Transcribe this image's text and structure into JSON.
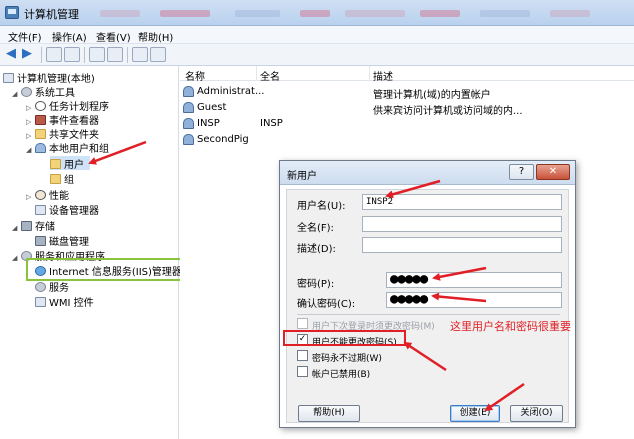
{
  "window": {
    "title": "计算机管理"
  },
  "menu": [
    "文件(F)",
    "操作(A)",
    "查看(V)",
    "帮助(H)"
  ],
  "tree": [
    {
      "label": "计算机管理(本地)",
      "icon": "computer-icon",
      "level": 0,
      "expanded": true
    },
    {
      "label": "系统工具",
      "icon": "tools-icon",
      "level": 1,
      "expanded": true
    },
    {
      "label": "任务计划程序",
      "icon": "clock-icon",
      "level": 2,
      "expanded": false
    },
    {
      "label": "事件查看器",
      "icon": "event-viewer-icon",
      "level": 2,
      "expanded": false
    },
    {
      "label": "共享文件夹",
      "icon": "shared-folder-icon",
      "level": 2,
      "expanded": false
    },
    {
      "label": "本地用户和组",
      "icon": "users-group-icon",
      "level": 2,
      "expanded": true
    },
    {
      "label": "用户",
      "icon": "folder-icon",
      "level": 3,
      "selected": true
    },
    {
      "label": "组",
      "icon": "folder-icon",
      "level": 3
    },
    {
      "label": "性能",
      "icon": "performance-icon",
      "level": 2,
      "expanded": false
    },
    {
      "label": "设备管理器",
      "icon": "device-manager-icon",
      "level": 2
    },
    {
      "label": "存储",
      "icon": "storage-icon",
      "level": 1,
      "expanded": true
    },
    {
      "label": "磁盘管理",
      "icon": "disk-icon",
      "level": 2
    },
    {
      "label": "服务和应用程序",
      "icon": "services-apps-icon",
      "level": 1,
      "expanded": true
    },
    {
      "label": "Internet 信息服务(IIS)管理器",
      "icon": "iis-icon",
      "level": 2
    },
    {
      "label": "服务",
      "icon": "services-icon",
      "level": 2
    },
    {
      "label": "WMI 控件",
      "icon": "wmi-icon",
      "level": 2
    }
  ],
  "list": {
    "columns": [
      "名称",
      "全名",
      "描述"
    ],
    "rows": [
      {
        "name": "Administrat...",
        "fullname": "",
        "description": "管理计算机(域)的内置帐户"
      },
      {
        "name": "Guest",
        "fullname": "",
        "description": "供来宾访问计算机或访问域的内..."
      },
      {
        "name": "INSP",
        "fullname": "INSP",
        "description": ""
      },
      {
        "name": "SecondPig",
        "fullname": "",
        "description": ""
      }
    ]
  },
  "dialog": {
    "title": "新用户",
    "help_button": "?",
    "close_button": "✕",
    "username_label": "用户名(U):",
    "username_value": "INSP2",
    "fullname_label": "全名(F):",
    "fullname_value": "",
    "description_label": "描述(D):",
    "description_value": "",
    "password_label": "密码(P):",
    "password_value": "●●●●●",
    "confirm_label": "确认密码(C):",
    "confirm_value": "●●●●●",
    "checkboxes": [
      {
        "label": "用户下次登录时须更改密码(M)",
        "checked": false,
        "disabled": true
      },
      {
        "label": "用户不能更改密码(S)",
        "checked": true,
        "disabled": false
      },
      {
        "label": "密码永不过期(W)",
        "checked": false,
        "disabled": false
      },
      {
        "label": "帐户已禁用(B)",
        "checked": false,
        "disabled": false
      }
    ],
    "help_label": "帮助(H)",
    "create_label": "创建(E)",
    "close_label": "关闭(O)"
  },
  "annotation": "这里用户名和密码很重要",
  "colors": {
    "annotation_red": "#e01f26",
    "highlight_green": "#8ac43d",
    "selection_blue": "#cfe3f8"
  }
}
